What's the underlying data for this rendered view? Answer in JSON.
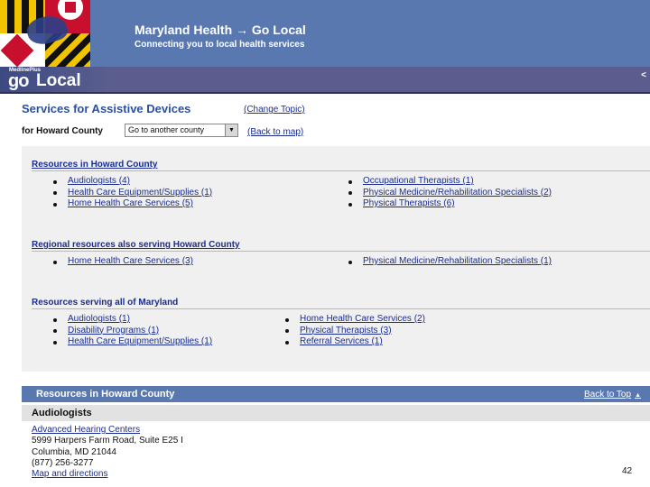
{
  "header": {
    "title": "Maryland Health → Go Local",
    "subtitle": "Connecting you to local health services"
  },
  "brand": {
    "medlineplus": "MedlinePlus",
    "go": "go",
    "local": "Local",
    "arrow": "<"
  },
  "services": {
    "title": "Services for Assistive Devices",
    "change_topic": "(Change Topic)",
    "county_label": "for Howard County",
    "county_select": "Go to another county",
    "back_map": "(Back to map)"
  },
  "resources_county": {
    "title": "Resources in Howard County",
    "left": [
      "Audiologists (4)",
      "Health Care Equipment/Supplies (1)",
      "Home Health Care Services (5)"
    ],
    "right": [
      "Occupational Therapists (1)",
      "Physical Medicine/Rehabilitation Specialists (2)",
      "Physical Therapists (6)"
    ]
  },
  "resources_regional": {
    "title": "Regional resources also serving Howard County",
    "left": [
      "Home Health Care Services (3)"
    ],
    "right": [
      "Physical Medicine/Rehabilitation Specialists (1)"
    ]
  },
  "resources_maryland": {
    "title": "Resources serving all of Maryland",
    "left": [
      "Audiologists (1)",
      "Disability Programs (1)",
      "Health Care Equipment/Supplies (1)"
    ],
    "right": [
      "Home Health Care Services (2)",
      "Physical Therapists (3)",
      "Referral Services (1)"
    ]
  },
  "bottom": {
    "bar_title": "Resources in Howard County",
    "back_to_top": "Back to Top",
    "category": "Audiologists",
    "provider_name": "Advanced Hearing Centers",
    "address1": "5999 Harpers Farm Road, Suite E25 I",
    "address2": "Columbia, MD 21044",
    "phone": "(877) 256-3277",
    "map_link": "Map and directions"
  },
  "page_number": "42",
  "colors": {
    "header_bg": "#5a78b0",
    "brand_bar": "#5a5d8e",
    "link": "#1a2d8f",
    "heading": "#2b4fa1",
    "panel_bg": "#f0f0f0"
  }
}
